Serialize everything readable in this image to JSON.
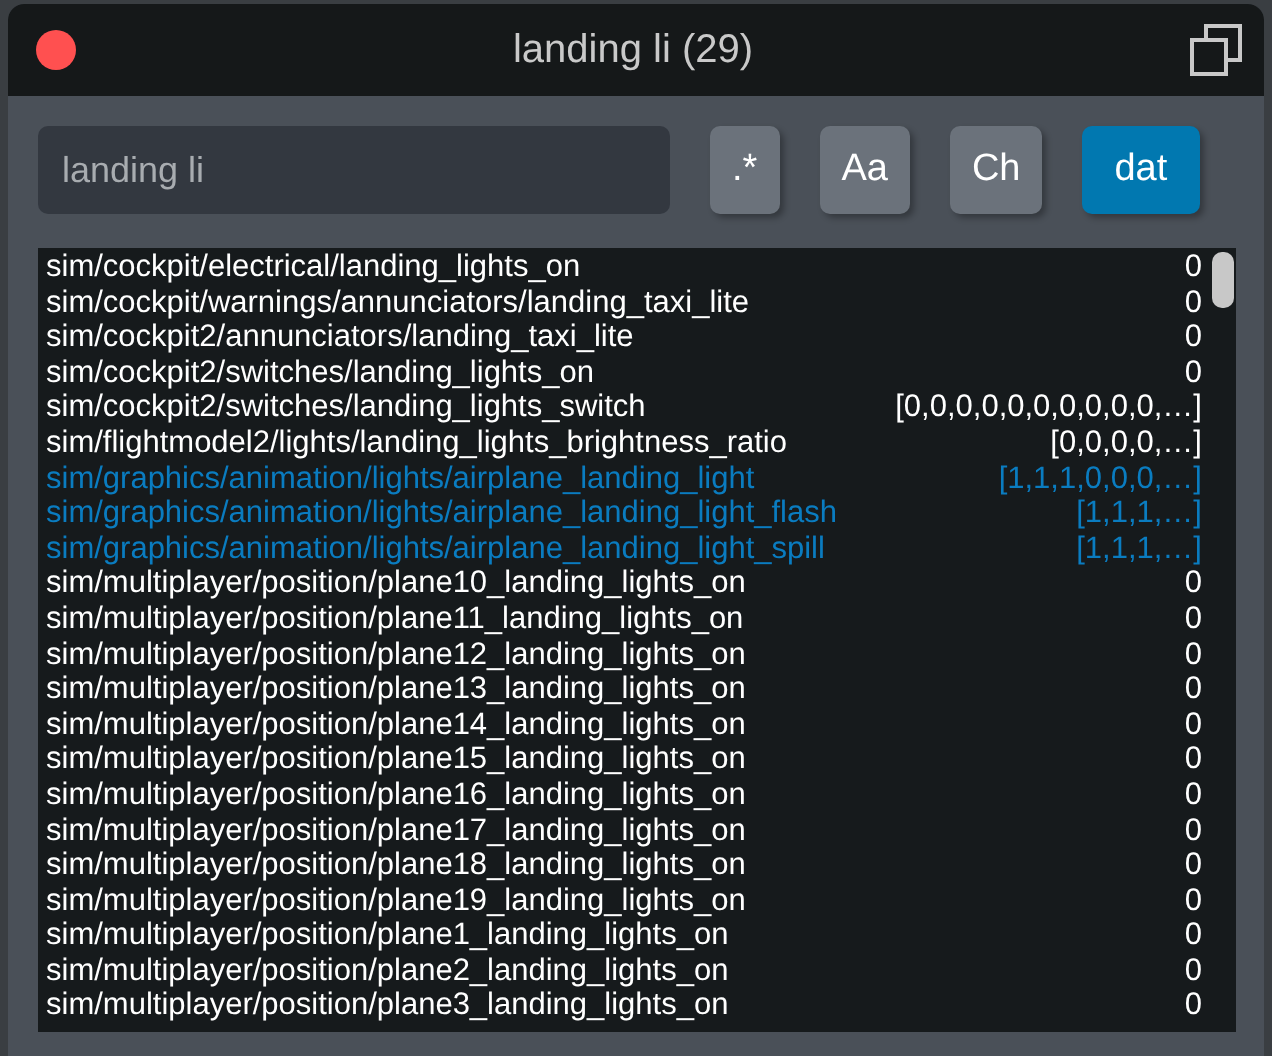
{
  "window": {
    "title": "landing li (29)"
  },
  "search": {
    "value": "landing li"
  },
  "toggles": [
    {
      "label": ".*",
      "selected": false
    },
    {
      "label": "Aa",
      "selected": false
    },
    {
      "label": "Ch",
      "selected": false
    },
    {
      "label": "dat",
      "selected": true
    }
  ],
  "rows": [
    {
      "name": "sim/cockpit/electrical/landing_lights_on",
      "value": "0",
      "highlighted": false
    },
    {
      "name": "sim/cockpit/warnings/annunciators/landing_taxi_lite",
      "value": "0",
      "highlighted": false
    },
    {
      "name": "sim/cockpit2/annunciators/landing_taxi_lite",
      "value": "0",
      "highlighted": false
    },
    {
      "name": "sim/cockpit2/switches/landing_lights_on",
      "value": "0",
      "highlighted": false
    },
    {
      "name": "sim/cockpit2/switches/landing_lights_switch",
      "value": "[0,0,0,0,0,0,0,0,0,0,…]",
      "highlighted": false
    },
    {
      "name": "sim/flightmodel2/lights/landing_lights_brightness_ratio",
      "value": "[0,0,0,0,…]",
      "highlighted": false
    },
    {
      "name": "sim/graphics/animation/lights/airplane_landing_light",
      "value": "[1,1,1,0,0,0,…]",
      "highlighted": true
    },
    {
      "name": "sim/graphics/animation/lights/airplane_landing_light_flash",
      "value": "[1,1,1,…]",
      "highlighted": true
    },
    {
      "name": "sim/graphics/animation/lights/airplane_landing_light_spill",
      "value": "[1,1,1,…]",
      "highlighted": true
    },
    {
      "name": "sim/multiplayer/position/plane10_landing_lights_on",
      "value": "0",
      "highlighted": false
    },
    {
      "name": "sim/multiplayer/position/plane11_landing_lights_on",
      "value": "0",
      "highlighted": false
    },
    {
      "name": "sim/multiplayer/position/plane12_landing_lights_on",
      "value": "0",
      "highlighted": false
    },
    {
      "name": "sim/multiplayer/position/plane13_landing_lights_on",
      "value": "0",
      "highlighted": false
    },
    {
      "name": "sim/multiplayer/position/plane14_landing_lights_on",
      "value": "0",
      "highlighted": false
    },
    {
      "name": "sim/multiplayer/position/plane15_landing_lights_on",
      "value": "0",
      "highlighted": false
    },
    {
      "name": "sim/multiplayer/position/plane16_landing_lights_on",
      "value": "0",
      "highlighted": false
    },
    {
      "name": "sim/multiplayer/position/plane17_landing_lights_on",
      "value": "0",
      "highlighted": false
    },
    {
      "name": "sim/multiplayer/position/plane18_landing_lights_on",
      "value": "0",
      "highlighted": false
    },
    {
      "name": "sim/multiplayer/position/plane19_landing_lights_on",
      "value": "0",
      "highlighted": false
    },
    {
      "name": "sim/multiplayer/position/plane1_landing_lights_on",
      "value": "0",
      "highlighted": false
    },
    {
      "name": "sim/multiplayer/position/plane2_landing_lights_on",
      "value": "0",
      "highlighted": false
    },
    {
      "name": "sim/multiplayer/position/plane3_landing_lights_on",
      "value": "0",
      "highlighted": false
    }
  ]
}
